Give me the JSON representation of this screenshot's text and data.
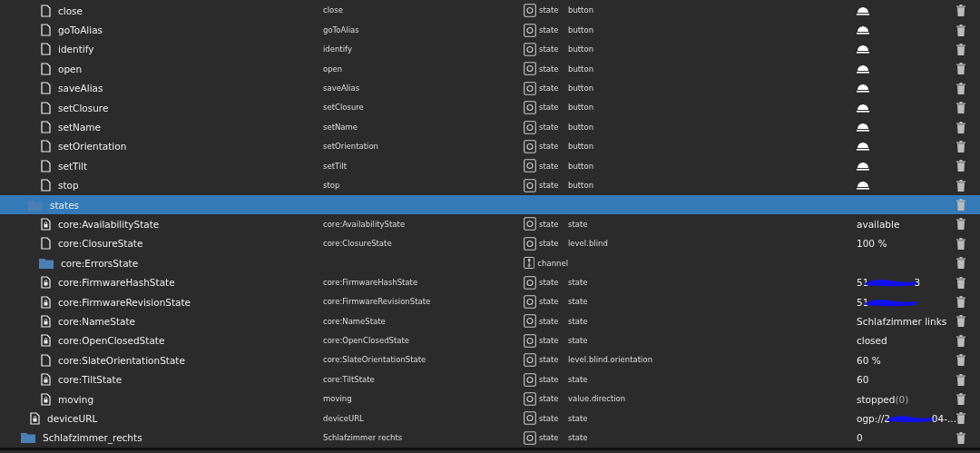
{
  "tree": [
    {
      "children": [
        {
          "children": [
            {
              "name": "close",
              "id": "close",
              "kind": "file",
              "type": "state",
              "role": "button",
              "bell": true,
              "selected": false
            },
            {
              "name": "goToAlias",
              "id": "goToAlias",
              "kind": "file",
              "type": "state",
              "role": "button",
              "bell": true,
              "selected": false
            },
            {
              "name": "identify",
              "id": "identify",
              "kind": "file",
              "type": "state",
              "role": "button",
              "bell": true,
              "selected": false
            },
            {
              "name": "open",
              "id": "open",
              "kind": "file",
              "type": "state",
              "role": "button",
              "bell": true,
              "selected": false
            },
            {
              "name": "saveAlias",
              "id": "saveAlias",
              "kind": "file",
              "type": "state",
              "role": "button",
              "bell": true,
              "selected": false
            },
            {
              "name": "setClosure",
              "id": "setClosure",
              "kind": "file",
              "type": "state",
              "role": "button",
              "bell": true,
              "selected": false
            },
            {
              "name": "setName",
              "id": "setName",
              "kind": "file",
              "type": "state",
              "role": "button",
              "bell": true,
              "selected": false
            },
            {
              "name": "setOrientation",
              "id": "setOrientation",
              "kind": "file",
              "type": "state",
              "role": "button",
              "bell": true,
              "selected": false
            },
            {
              "name": "setTilt",
              "id": "setTilt",
              "kind": "file",
              "type": "state",
              "role": "button",
              "bell": true,
              "selected": false
            },
            {
              "name": "stop",
              "id": "stop",
              "kind": "file",
              "type": "state",
              "role": "button",
              "bell": true,
              "selected": false
            }
          ]
        },
        {
          "name": "states",
          "kind": "folder",
          "selected": true,
          "children": [
            {
              "name": "core:AvailabilityState",
              "id": "core:AvailabilityState",
              "kind": "locked",
              "type": "state",
              "role": "state",
              "value": "available",
              "selected": false
            },
            {
              "name": "core:ClosureState",
              "id": "core:ClosureState",
              "kind": "file",
              "type": "state",
              "role": "level.blind",
              "value": "100 %",
              "selected": false
            },
            {
              "name": "core:ErrorsState",
              "kind": "channel",
              "type": "channel",
              "selected": false
            },
            {
              "name": "core:FirmwareHashState",
              "id": "core:FirmwareHashState",
              "kind": "locked",
              "type": "state",
              "role": "state",
              "value": "51",
              "redacted": true,
              "value_tail": "3",
              "selected": false
            },
            {
              "name": "core:FirmwareRevisionState",
              "id": "core:FirmwareRevisionState",
              "kind": "locked",
              "type": "state",
              "role": "state",
              "value": "51",
              "redacted": true,
              "selected": false
            },
            {
              "name": "core:NameState",
              "id": "core:NameState",
              "kind": "locked",
              "type": "state",
              "role": "state",
              "value": "Schlafzimmer links",
              "selected": false
            },
            {
              "name": "core:OpenClosedState",
              "id": "core:OpenClosedState",
              "kind": "locked",
              "type": "state",
              "role": "state",
              "value": "closed",
              "selected": false
            },
            {
              "name": "core:SlateOrientationState",
              "id": "core:SlateOrientationState",
              "kind": "file",
              "type": "state",
              "role": "level.blind.orientation",
              "value": "60 %",
              "selected": false
            },
            {
              "name": "core:TiltState",
              "id": "core:TiltState",
              "kind": "locked",
              "type": "state",
              "role": "state",
              "value": "60",
              "selected": false
            },
            {
              "name": "moving",
              "id": "moving",
              "kind": "locked",
              "type": "state",
              "role": "value.direction",
              "value": "stopped",
              "value_suffix": "(0)",
              "selected": false
            }
          ]
        },
        {
          "name": "deviceURL",
          "id": "deviceURL",
          "kind": "locked",
          "type": "state",
          "role": "state",
          "value": "ogp://2",
          "redacted": true,
          "value_tail": "04-...",
          "selected": false
        }
      ]
    },
    {
      "name": "Schlafzimmer_rechts",
      "id": "Schlafzimmer rechts",
      "kind": "folder",
      "type": "state",
      "role": "state",
      "value": "0",
      "selected": false
    }
  ]
}
